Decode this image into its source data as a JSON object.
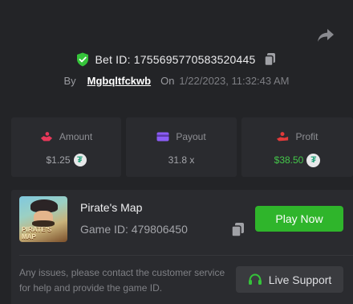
{
  "header": {
    "bet_label": "Bet ID:",
    "bet_id": "1755695770583520445",
    "by_label": "By",
    "username": "Mgbqltfckwb",
    "on_label": "On",
    "timestamp": "1/22/2023, 11:32:43 AM"
  },
  "stats": {
    "amount": {
      "label": "Amount",
      "value": "$1.25",
      "currency_icon": "tether-icon"
    },
    "payout": {
      "label": "Payout",
      "value": "31.8 x"
    },
    "profit": {
      "label": "Profit",
      "value": "$38.50",
      "currency_icon": "tether-icon"
    }
  },
  "game": {
    "title": "Pirate's Map",
    "id_label": "Game ID: 479806450",
    "thumb_line1": "PIRATE'S",
    "thumb_line2": "MAP",
    "play_label": "Play Now"
  },
  "support": {
    "message": "Any issues, please contact the customer service for help and provide the game ID.",
    "button_label": "Live Support"
  },
  "colors": {
    "background": "#232427",
    "card": "#2a2b2f",
    "accent_green": "#2fb52b",
    "profit_green": "#44c64a",
    "amount_icon": "#e8385a",
    "payout_icon": "#8b5cf6",
    "profit_icon": "#e13a3a",
    "tether_green": "#26a17b"
  }
}
